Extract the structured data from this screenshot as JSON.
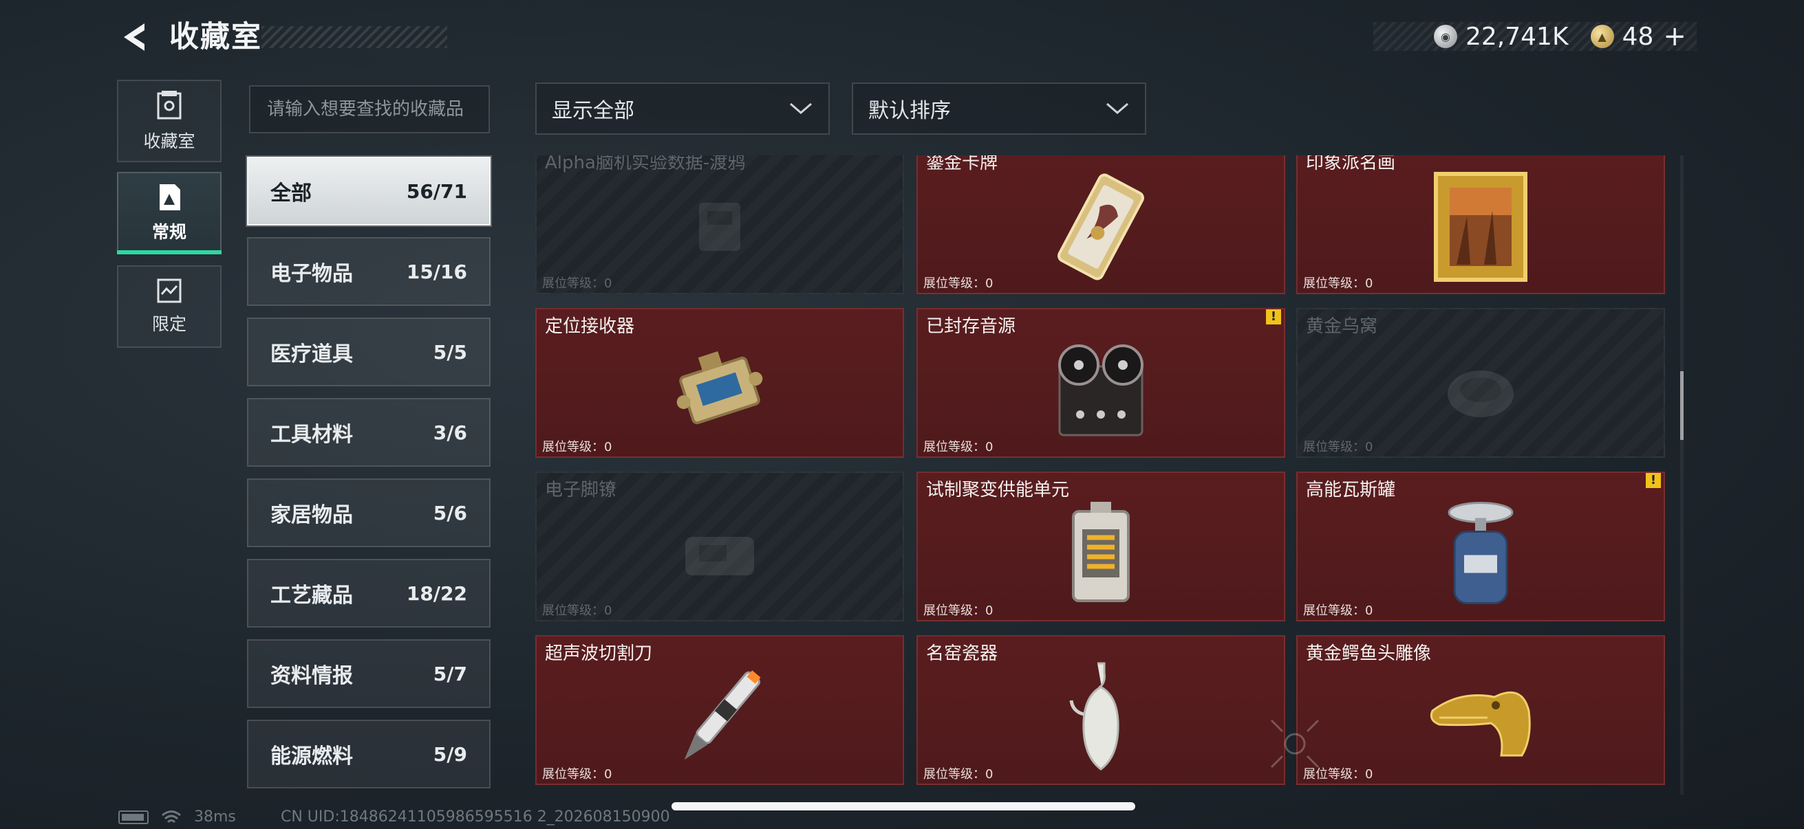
{
  "header": {
    "title": "收藏室",
    "back_icon": "back-arrow-icon"
  },
  "currency": {
    "coins": "22,741K",
    "tokens": "48",
    "plus": "+"
  },
  "nav": {
    "tabs": [
      {
        "label": "收藏室",
        "icon": "collection-icon",
        "active": false
      },
      {
        "label": "常规",
        "icon": "regular-icon",
        "active": true
      },
      {
        "label": "限定",
        "icon": "limited-icon",
        "active": false
      }
    ],
    "accent": "#2fd6a4"
  },
  "search": {
    "placeholder": "请输入想要查找的收藏品"
  },
  "filters": {
    "show": "显示全部",
    "sort": "默认排序"
  },
  "categories": [
    {
      "name": "全部",
      "count": "56/71",
      "active": true
    },
    {
      "name": "电子物品",
      "count": "15/16"
    },
    {
      "name": "医疗道具",
      "count": "5/5"
    },
    {
      "name": "工具材料",
      "count": "3/6"
    },
    {
      "name": "家居物品",
      "count": "5/6"
    },
    {
      "name": "工艺藏品",
      "count": "18/22"
    },
    {
      "name": "资料情报",
      "count": "5/7"
    },
    {
      "name": "能源燃料",
      "count": "5/9"
    }
  ],
  "level_label": "展位等级：0",
  "items": [
    {
      "name": "Alpha脑机实验数据-渡鸦",
      "owned": false,
      "icon": "data-drive-icon"
    },
    {
      "name": "鎏金卡牌",
      "owned": true,
      "icon": "gilded-card-icon"
    },
    {
      "name": "印象派名画",
      "owned": true,
      "icon": "painting-icon"
    },
    {
      "name": "定位接收器",
      "owned": true,
      "icon": "locator-receiver-icon"
    },
    {
      "name": "已封存音源",
      "owned": true,
      "icon": "reel-recorder-icon",
      "alert": "!"
    },
    {
      "name": "黄金乌窝",
      "owned": false,
      "icon": "golden-nest-icon"
    },
    {
      "name": "电子脚镣",
      "owned": false,
      "icon": "ankle-monitor-icon"
    },
    {
      "name": "试制聚变供能单元",
      "owned": true,
      "icon": "fusion-cell-icon"
    },
    {
      "name": "高能瓦斯罐",
      "owned": true,
      "icon": "gas-canister-icon",
      "alert": "!"
    },
    {
      "name": "超声波切割刀",
      "owned": true,
      "icon": "ultrasonic-knife-icon"
    },
    {
      "name": "名窑瓷器",
      "owned": true,
      "icon": "porcelain-vase-icon"
    },
    {
      "name": "黄金鳄鱼头雕像",
      "owned": true,
      "icon": "gold-crocodile-icon"
    }
  ],
  "status": {
    "ping": "38ms",
    "uid": "CN UID:18486241105986595516 2_202608150900"
  }
}
